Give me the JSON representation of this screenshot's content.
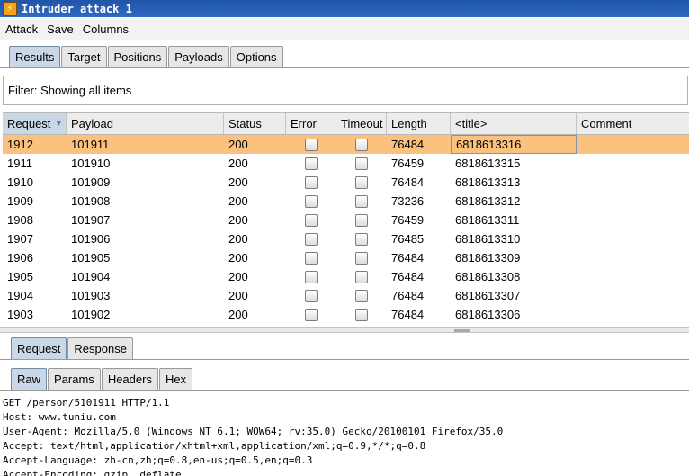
{
  "window": {
    "title": "Intruder attack 1"
  },
  "menu": [
    "Attack",
    "Save",
    "Columns"
  ],
  "main_tabs": [
    {
      "label": "Results",
      "active": true
    },
    {
      "label": "Target",
      "active": false
    },
    {
      "label": "Positions",
      "active": false
    },
    {
      "label": "Payloads",
      "active": false
    },
    {
      "label": "Options",
      "active": false
    }
  ],
  "filter": {
    "text": "Filter: Showing all items"
  },
  "table": {
    "columns": [
      "Request",
      "Payload",
      "Status",
      "Error",
      "Timeout",
      "Length",
      "<title>",
      "Comment"
    ],
    "sorted_column": "Request",
    "rows": [
      {
        "request": "1912",
        "payload": "101911",
        "status": "200",
        "error": false,
        "timeout": false,
        "length": "76484",
        "title": "6818613316",
        "comment": "",
        "selected": true
      },
      {
        "request": "1911",
        "payload": "101910",
        "status": "200",
        "error": false,
        "timeout": false,
        "length": "76459",
        "title": "6818613315",
        "comment": ""
      },
      {
        "request": "1910",
        "payload": "101909",
        "status": "200",
        "error": false,
        "timeout": false,
        "length": "76484",
        "title": "6818613313",
        "comment": ""
      },
      {
        "request": "1909",
        "payload": "101908",
        "status": "200",
        "error": false,
        "timeout": false,
        "length": "73236",
        "title": "6818613312",
        "comment": ""
      },
      {
        "request": "1908",
        "payload": "101907",
        "status": "200",
        "error": false,
        "timeout": false,
        "length": "76459",
        "title": "6818613311",
        "comment": ""
      },
      {
        "request": "1907",
        "payload": "101906",
        "status": "200",
        "error": false,
        "timeout": false,
        "length": "76485",
        "title": "6818613310",
        "comment": ""
      },
      {
        "request": "1906",
        "payload": "101905",
        "status": "200",
        "error": false,
        "timeout": false,
        "length": "76484",
        "title": "6818613309",
        "comment": ""
      },
      {
        "request": "1905",
        "payload": "101904",
        "status": "200",
        "error": false,
        "timeout": false,
        "length": "76484",
        "title": "6818613308",
        "comment": ""
      },
      {
        "request": "1904",
        "payload": "101903",
        "status": "200",
        "error": false,
        "timeout": false,
        "length": "76484",
        "title": "6818613307",
        "comment": ""
      },
      {
        "request": "1903",
        "payload": "101902",
        "status": "200",
        "error": false,
        "timeout": false,
        "length": "76484",
        "title": "6818613306",
        "comment": ""
      }
    ]
  },
  "detail_tabs": [
    {
      "label": "Request",
      "active": true
    },
    {
      "label": "Response",
      "active": false
    }
  ],
  "view_tabs": [
    {
      "label": "Raw",
      "active": true
    },
    {
      "label": "Params",
      "active": false
    },
    {
      "label": "Headers",
      "active": false
    },
    {
      "label": "Hex",
      "active": false
    }
  ],
  "raw_request": [
    "GET /person/5101911 HTTP/1.1",
    "Host: www.tuniu.com",
    "User-Agent: Mozilla/5.0 (Windows NT 6.1; WOW64; rv:35.0) Gecko/20100101 Firefox/35.0",
    "Accept: text/html,application/xhtml+xml,application/xml;q=0.9,*/*;q=0.8",
    "Accept-Language: zh-cn,zh;q=0.8,en-us;q=0.5,en;q=0.3",
    "Accept-Encoding: gzip, deflate"
  ],
  "colors": {
    "selected_row": "#fbc17e",
    "active_tab": "#c9d7e6",
    "titlebar": "#1f55a8"
  }
}
